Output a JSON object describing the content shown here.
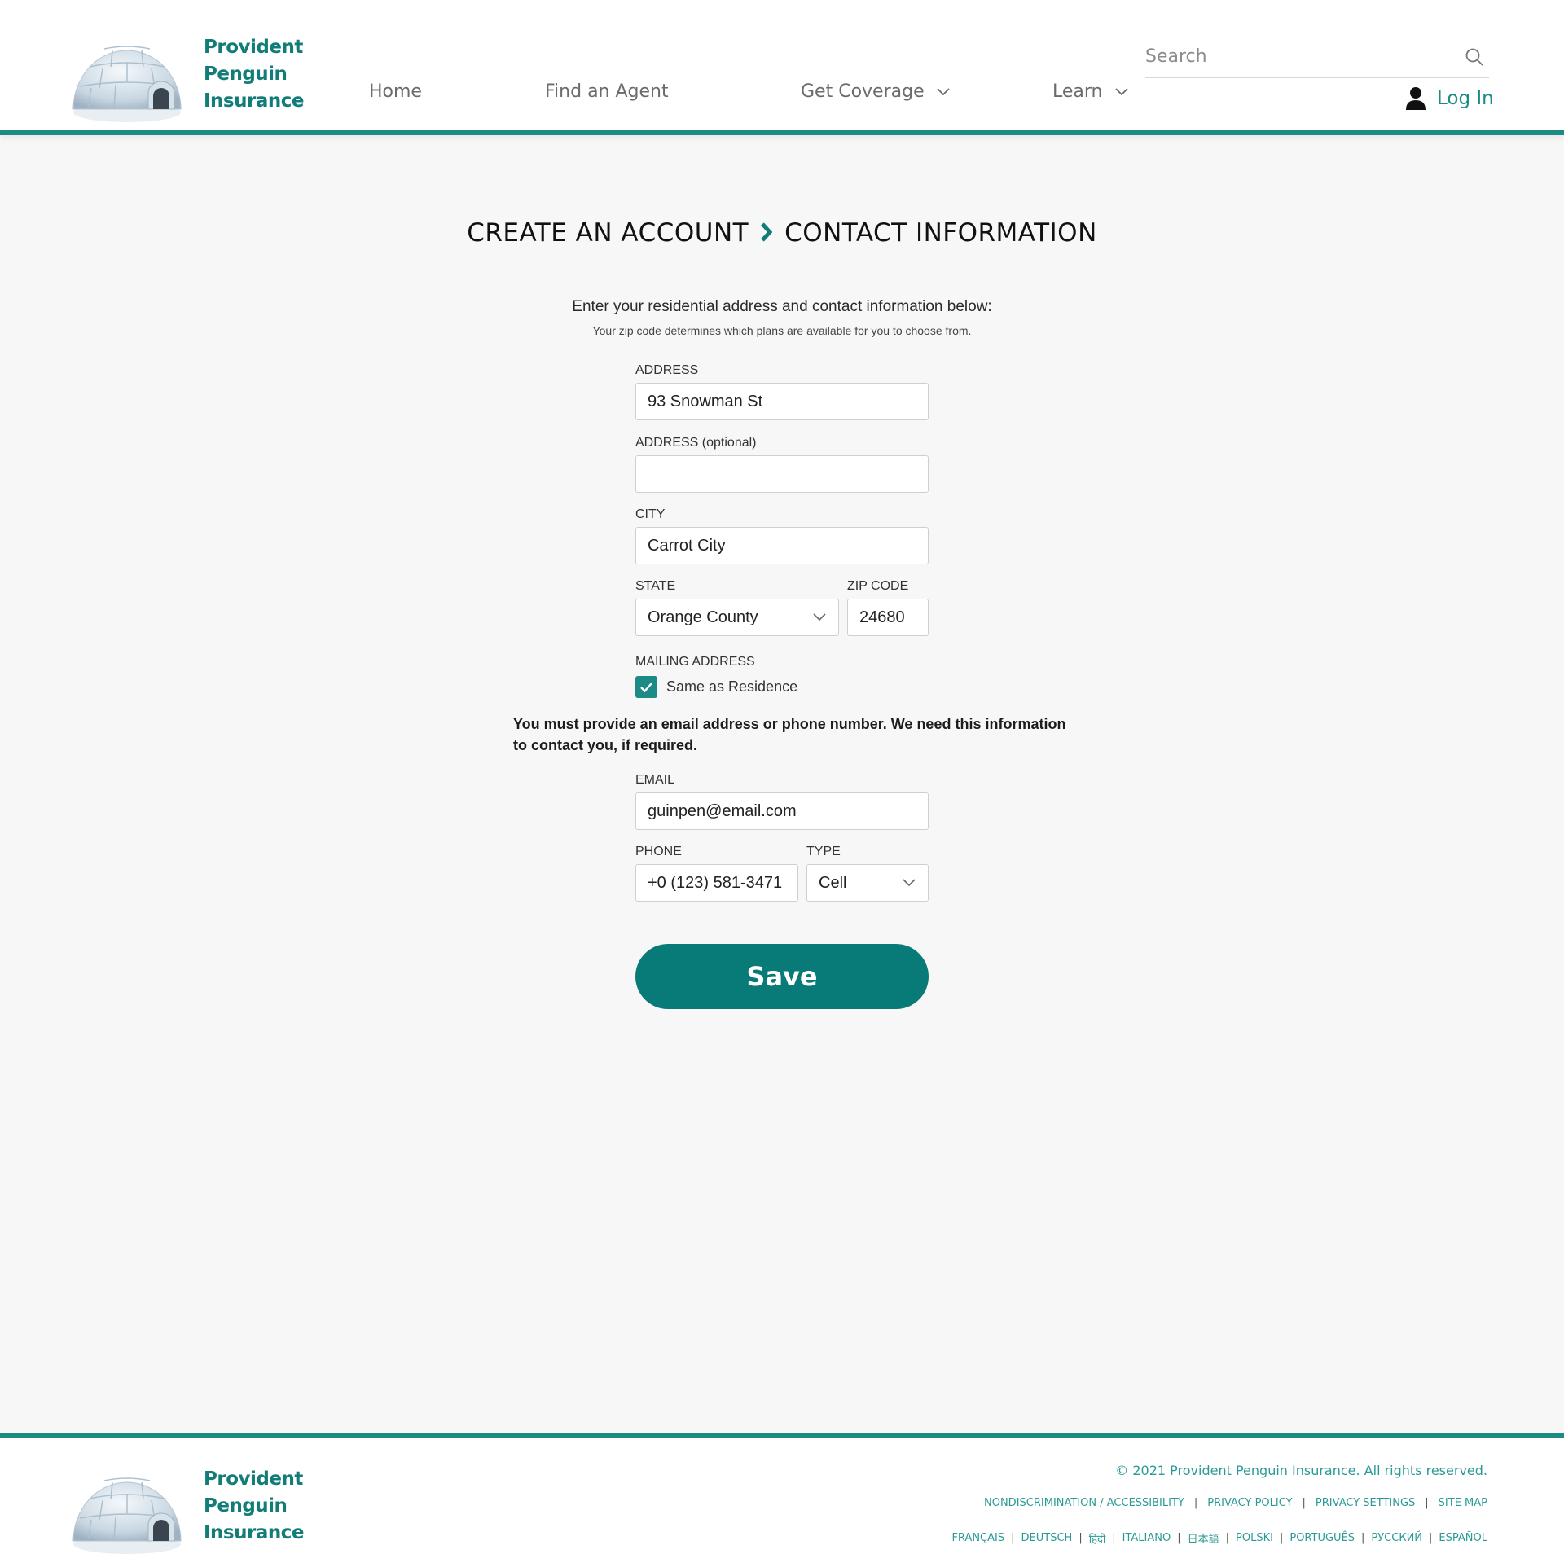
{
  "brand": {
    "line1": "Provident",
    "line2": "Penguin",
    "line3": "Insurance",
    "logo_icon": "igloo-icon",
    "accent_color": "#1c8b86"
  },
  "nav": {
    "home": "Home",
    "find_agent": "Find an Agent",
    "get_coverage": "Get Coverage",
    "learn": "Learn"
  },
  "search": {
    "placeholder": "Search"
  },
  "login": {
    "label": "Log In"
  },
  "breadcrumb": {
    "step1": "CREATE AN ACCOUNT",
    "step2": "CONTACT INFORMATION"
  },
  "intro": {
    "text": "Enter your residential address and contact information below:",
    "sub": "Your zip code determines which plans are available for you to choose from."
  },
  "form": {
    "address_label": "ADDRESS",
    "address_value": "93 Snowman St",
    "address2_label": "ADDRESS (optional)",
    "address2_value": "",
    "city_label": "CITY",
    "city_value": "Carrot City",
    "state_label": "STATE",
    "state_value": "Orange County",
    "zip_label": "ZIP CODE",
    "zip_value": "24680",
    "mailing_label": "MAILING ADDRESS",
    "same_as_residence": "Same as Residence",
    "same_as_residence_checked": true,
    "notice": "You must provide an email address or phone number. We need this information to contact you, if required.",
    "email_label": "EMAIL",
    "email_value": "guinpen@email.com",
    "phone_label": "PHONE",
    "phone_value": "+0 (123) 581-3471",
    "type_label": "TYPE",
    "type_value": "Cell",
    "save_label": "Save"
  },
  "footer": {
    "copyright": "© 2021 Provident Penguin Insurance. All rights reserved.",
    "links": [
      "NONDISCRIMINATION / ACCESSIBILITY",
      "PRIVACY POLICY",
      "PRIVACY SETTINGS",
      "SITE MAP"
    ],
    "languages": [
      "FRANÇAIS",
      "DEUTSCH",
      "हिंदी",
      "ITALIANO",
      "日本語",
      "POLSKI",
      "PORTUGUÊS",
      "РУССКИЙ",
      "ESPAÑOL"
    ]
  }
}
